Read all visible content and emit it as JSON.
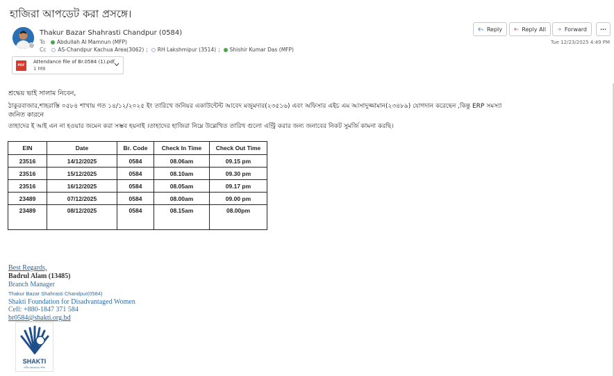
{
  "email": {
    "subject": "হাজিরা আপডেট করা প্রসঙ্গে।",
    "sender": "Thakur Bazar Shahrasti Chandpur (0584)",
    "to_label": "To",
    "to": [
      {
        "name": "Abdullah Al Mamnun (MFP)",
        "status": "available",
        "sep": ""
      }
    ],
    "cc_label": "Cc",
    "cc": [
      {
        "name": "AS-Chandpur Kachua Area(3062)",
        "status": "offline",
        "sep": ";"
      },
      {
        "name": "RH Lakshmipur (3514)",
        "status": "offline",
        "sep": ";"
      },
      {
        "name": "Shishir Kumar Das (MFP)",
        "status": "available",
        "sep": ""
      }
    ],
    "date": "Tue 12/23/2025 4:49 PM",
    "status_colors": {
      "available": "#4aa84a",
      "offline": "#9db5cf"
    }
  },
  "actions": {
    "reply": "Reply",
    "reply_all": "Reply All",
    "forward": "Forward",
    "more": "···"
  },
  "attachment": {
    "name": "Attendance file of Br.0584 (1).pdf",
    "size": "1 MB",
    "icon_label": "PDF"
  },
  "body": {
    "greeting": "শ্রদ্ধেয় ভাই সালাম নিবেন,",
    "line1": "ঠাকুরবাজার,শাহরাস্তি ০৫৮৪ শাখায় গত ১৪/১২/২০২৫ ইং তারিখে জনিয়র একাউন্টেন্ট আবেদ মজুমদার(২৩৫১৬) এবং অফিসার এইচ এম আসাদুজ্জামান(২৩৪৮৯) যোগদান করেছেন ,কিন্তু ERP সমস্যা",
    "line2": "জনিত কারনে",
    "line3": "তাহাদের ই আই এন না হওয়ার জমেন করা সম্ভব হয়নাই ।তাহাদের হাজিরা নিম্নে উল্লেখিত তারিখ গুলো এন্ট্রি করার জন্য জনাবের নিকট সুমর্জি কামনা করছি।"
  },
  "table": {
    "headers": [
      "EIN",
      "Date",
      "Br. Code",
      "Check In Time",
      "Check Out Time"
    ],
    "rows": [
      [
        "23516",
        "14/12/2025",
        "0584",
        "08.06am",
        "09.15 pm"
      ],
      [
        "23516",
        "15/12/2025",
        "0584",
        "08.10am",
        "09.30 pm"
      ],
      [
        "23516",
        "16/12/2025",
        "0584",
        "08.05am",
        "09.17 pm"
      ],
      [
        "23489",
        "07/12/2025",
        "0584",
        "08.00am",
        "09.00 pm"
      ],
      [
        "23489",
        "08/12/2025",
        "0584",
        "08.15am",
        "08.00pm"
      ]
    ]
  },
  "signature": {
    "regards": "Best Regards,",
    "name": "Badrul Alam (13485)",
    "title": "Branch Manager",
    "branch": "Thakur Bazar Shahrasti Chandpur(0584)",
    "org": "Shakti Foundation for Disadvantaged Women",
    "cell": "Cell: +880-1847 371 584",
    "email": "br0584@shakti.org.bd",
    "logo_text": "SHAKTI",
    "logo_tagline": "নারীর ক্ষমতায়নে শক্তি"
  }
}
